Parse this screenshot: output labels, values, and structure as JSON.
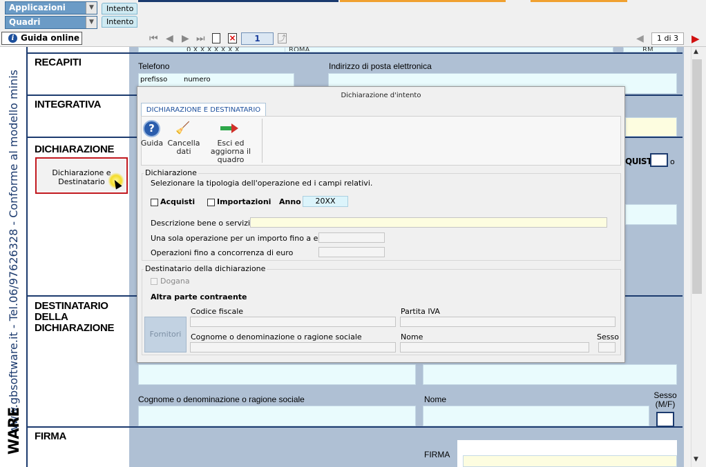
{
  "topbar": {
    "applicazioni": "Applicazioni",
    "quadri": "Quadri",
    "tab1": "Intento",
    "tab2": "Intento"
  },
  "nav": {
    "guida_label": "Guida online",
    "page": "1",
    "page_count": "1 di 3"
  },
  "leftstrip": {
    "vertical_text": "www.gbsoftware.it - Tel.06/97626328 - Conforme al modello minis",
    "bottom_text": "WARE"
  },
  "form": {
    "top_partial_left": "0 X X X X X X X",
    "top_partial_right": "ROMA",
    "top_partial_rm": "RM",
    "recapiti": "RECAPITI",
    "telefono": "Telefono",
    "prefisso": "prefisso",
    "numero": "numero",
    "email": "Indirizzo di posta elettronica",
    "integrativa": "INTEGRATIVA",
    "dichiarazione": "DICHIARAZIONE",
    "dich_button": "Dichiarazione e Destinatario",
    "acquisti_partial": "QUISTI",
    "o_partial": "o",
    "destinatario": "DESTINATARIO DELLA DICHIARAZIONE",
    "cognome": "Cognome o denominazione o ragione sociale",
    "nome": "Nome",
    "sesso": "Sesso (M/F)",
    "firma_section": "FIRMA",
    "firma_label": "FIRMA"
  },
  "modal": {
    "title": "Dichiarazione d'intento",
    "tab": "DICHIARAZIONE E DESTINATARIO",
    "toolbar": {
      "guida": "Guida",
      "cancella": "Cancella dati",
      "esci": "Esci ed aggiorna il quadro"
    },
    "dichiarazione_group": "Dichiarazione",
    "instruction": "Selezionare la tipologia dell'operazione ed i campi relativi.",
    "acquisti": "Acquisti",
    "importazioni": "Importazioni",
    "anno_label": "Anno",
    "anno_value": "20XX",
    "descrizione": "Descrizione bene o servizio",
    "una_sola": "Una sola operazione per un importo fino a euro",
    "operazioni_fino": "Operazioni fino a concorrenza di euro",
    "destinatario_group": "Destinatario della dichiarazione",
    "dogana": "Dogana",
    "altra_parte": "Altra parte contraente",
    "fornitori": "Fornitori",
    "codice_fiscale": "Codice fiscale",
    "partita_iva": "Partita IVA",
    "cognome": "Cognome o denominazione o ragione sociale",
    "nome": "Nome",
    "sesso": "Sesso"
  },
  "colors": {
    "form_blue": "#afc0d4",
    "field_cyan": "#e9fbfd",
    "field_yellow": "#fdfde0",
    "navy": "#1b3a6e",
    "button_border_red": "#c0161c"
  }
}
